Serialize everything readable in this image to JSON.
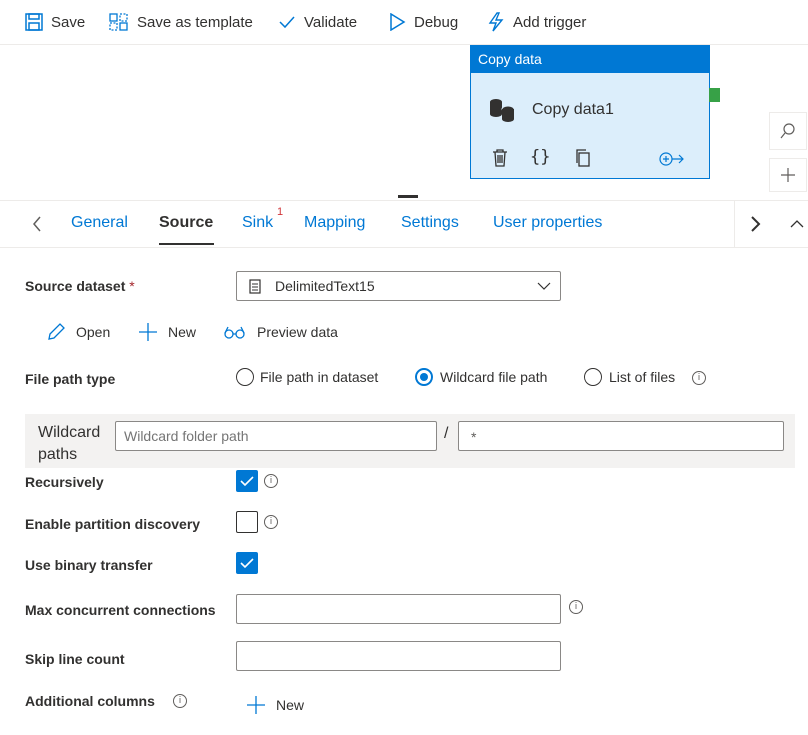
{
  "toolbar": {
    "save": "Save",
    "save_template": "Save as template",
    "validate": "Validate",
    "debug": "Debug",
    "add_trigger": "Add trigger"
  },
  "activity": {
    "type": "Copy data",
    "name": "Copy data1"
  },
  "tabs": {
    "items": [
      "General",
      "Source",
      "Sink",
      "Mapping",
      "Settings",
      "User properties"
    ],
    "active": "Source",
    "sink_badge": "1"
  },
  "form": {
    "source_dataset_label": "Source dataset",
    "required_mark": "*",
    "source_dataset_value": "DelimitedText15",
    "actions": {
      "open": "Open",
      "new": "New",
      "preview": "Preview data"
    },
    "file_path_type_label": "File path type",
    "file_path_options": [
      "File path in dataset",
      "Wildcard file path",
      "List of files"
    ],
    "file_path_selected": "Wildcard file path",
    "wildcard_label_1": "Wildcard",
    "wildcard_label_2": "paths",
    "wildcard_folder_placeholder": "Wildcard folder path",
    "path_separator": "/",
    "wildcard_file_value": "*",
    "recursively_label": "Recursively",
    "recursively_checked": true,
    "partition_label": "Enable partition discovery",
    "partition_checked": false,
    "binary_label": "Use binary transfer",
    "binary_checked": true,
    "max_conn_label": "Max concurrent connections",
    "max_conn_value": "",
    "skip_line_label": "Skip line count",
    "skip_line_value": "",
    "additional_columns_label": "Additional columns",
    "additional_new": "New"
  },
  "colors": {
    "accent": "#0078d4",
    "activity_bg": "#dceefb",
    "connector": "#37a147",
    "error": "#d13438"
  },
  "icons": [
    "save-icon",
    "template-icon",
    "check-icon",
    "play-icon",
    "trigger-icon",
    "database-icon",
    "delete-icon",
    "code-icon",
    "copy-icon",
    "add-output-icon",
    "search-icon",
    "plus-icon",
    "chevron-left-icon",
    "chevron-right-icon",
    "chevron-up-icon",
    "dataset-icon",
    "chevron-down-icon",
    "pencil-icon",
    "glasses-icon",
    "info-icon"
  ]
}
